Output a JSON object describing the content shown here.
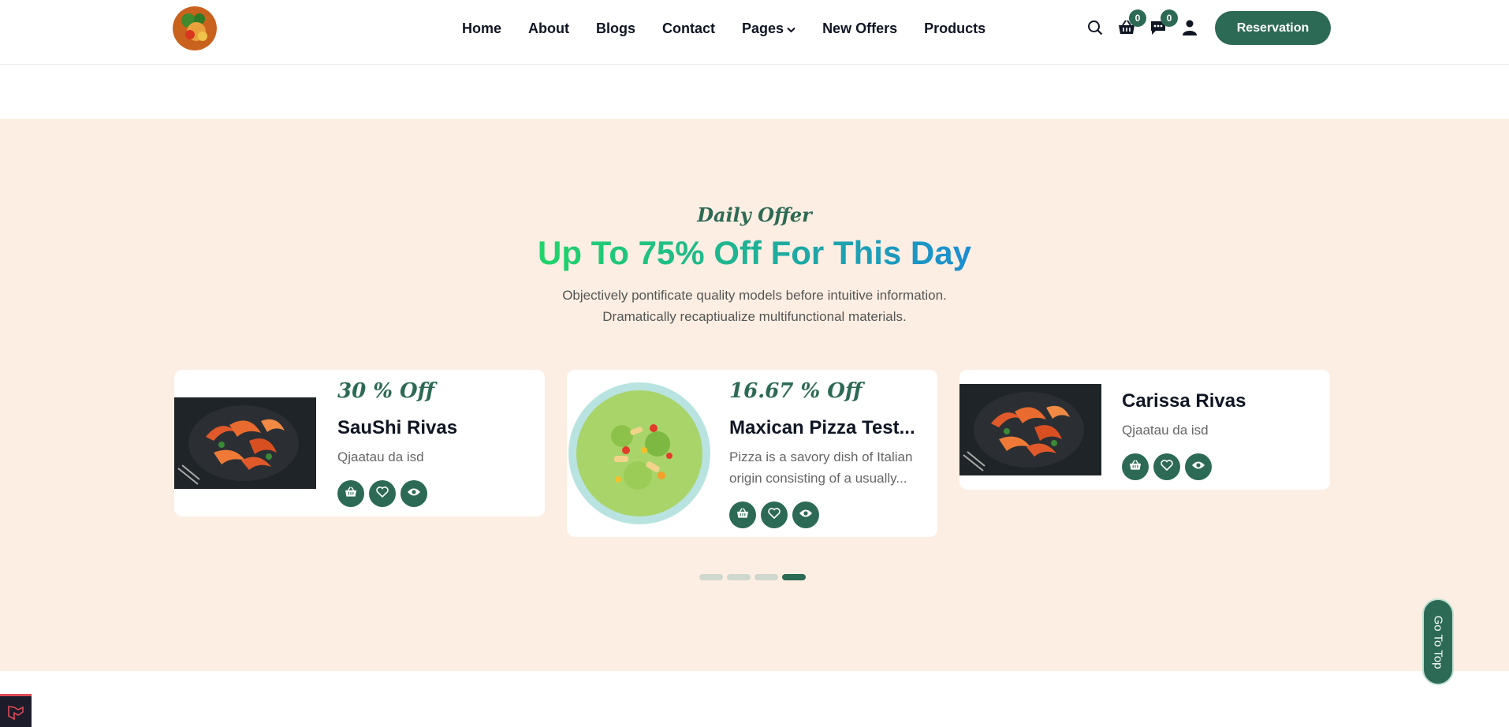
{
  "header": {
    "nav": [
      {
        "label": "Home"
      },
      {
        "label": "About"
      },
      {
        "label": "Blogs"
      },
      {
        "label": "Contact"
      },
      {
        "label": "Pages",
        "dropdown": true
      },
      {
        "label": "New Offers"
      },
      {
        "label": "Products"
      }
    ],
    "cart_count": "0",
    "messages_count": "0",
    "reservation_label": "Reservation"
  },
  "offer": {
    "subtitle": "Daily Offer",
    "title": "Up To 75% Off For This Day",
    "description_line1": "Objectively pontificate quality models before intuitive information.",
    "description_line2": "Dramatically recaptiualize multifunctional materials.",
    "cards": [
      {
        "discount": "30 % Off",
        "title": "SauShi Rivas",
        "description": "Qjaatau da isd"
      },
      {
        "discount": "16.67 % Off",
        "title": "Maxican Pizza Test...",
        "description_line1": "Pizza is a savory dish of Italian",
        "description_line2": "origin consisting of a usually..."
      },
      {
        "title": "Carissa Rivas",
        "description": "Qjaatau da isd"
      }
    ],
    "carousel": {
      "slides": 4,
      "active_index": 3
    }
  },
  "go_top_label": "Go To Top",
  "colors": {
    "accent": "#2d6a55",
    "section_bg": "#fdeee3"
  }
}
